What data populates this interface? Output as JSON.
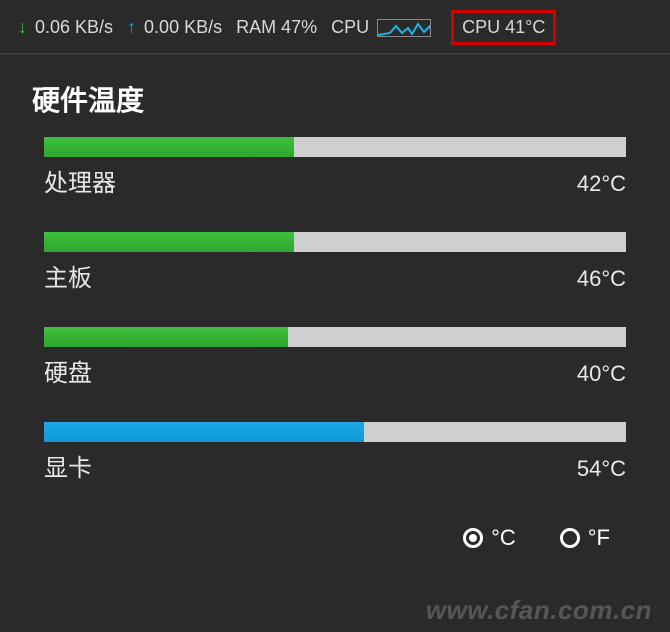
{
  "topbar": {
    "download_speed": "0.06 KB/s",
    "upload_speed": "0.00 KB/s",
    "ram_label": "RAM 47%",
    "cpu_label": "CPU",
    "cpu_temp": "CPU 41°C"
  },
  "section_title": "硬件温度",
  "temps": [
    {
      "name": "处理器",
      "value": "42°C",
      "fill_percent": 43,
      "color": "green"
    },
    {
      "name": "主板",
      "value": "46°C",
      "fill_percent": 43,
      "color": "green"
    },
    {
      "name": "硬盘",
      "value": "40°C",
      "fill_percent": 42,
      "color": "green"
    },
    {
      "name": "显卡",
      "value": "54°C",
      "fill_percent": 55,
      "color": "blue"
    }
  ],
  "units": {
    "celsius": "°C",
    "fahrenheit": "°F",
    "selected": "celsius"
  },
  "watermark": "www.cfan.com.cn"
}
